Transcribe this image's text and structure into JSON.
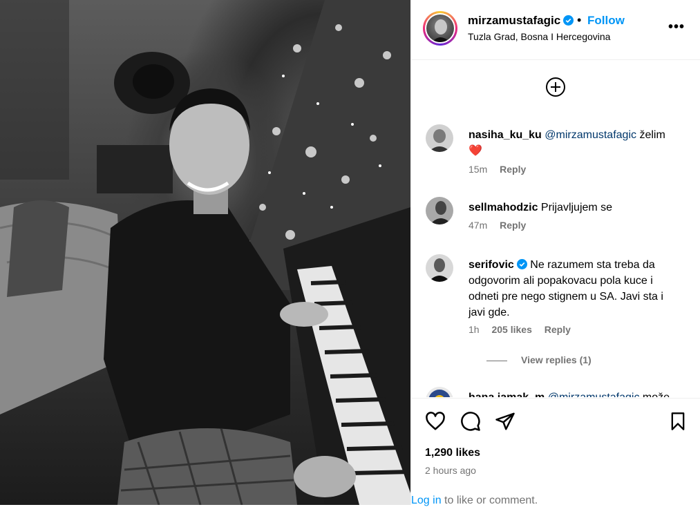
{
  "post": {
    "image_alt": "Photo of a man playing piano beside a Christmas tree"
  },
  "header": {
    "username": "mirzamustafagic",
    "dot": "•",
    "follow_label": "Follow",
    "location": "Tuzla Grad, Bosna I Hercegovina",
    "more_label": "•••"
  },
  "comments": [
    {
      "user": "nasiha_ku_ku",
      "mention": "@mirzamustafagic",
      "text": " želim",
      "emoji": "❤️",
      "time": "15m",
      "reply": "Reply"
    },
    {
      "user": "sellmahodzic",
      "text": " Prijavljujem se",
      "time": "47m",
      "reply": "Reply"
    },
    {
      "user": "serifovic",
      "text": " Ne razumem sta treba da odgovorim ali popakovacu pola kuce i odneti pre nego stignem u SA. Javi sta i javi gde.",
      "time": "1h",
      "likes": "205 likes",
      "reply": "Reply",
      "view_replies": "View replies (1)"
    },
    {
      "user": "hana.jamak_m",
      "mention": "@mirzamustafagic",
      "text": " može"
    }
  ],
  "footer": {
    "likes": "1,290 likes",
    "time": "2 hours ago",
    "login_link": "Log in",
    "login_text": " to like or comment."
  },
  "colors": {
    "accent": "#0095f6",
    "muted": "#737373",
    "mention": "#00376b",
    "heart": "#ff3040"
  },
  "icons": [
    "verified-icon",
    "add-comment-icon",
    "heart-icon",
    "comment-icon",
    "share-icon",
    "bookmark-icon",
    "more-icon"
  ]
}
